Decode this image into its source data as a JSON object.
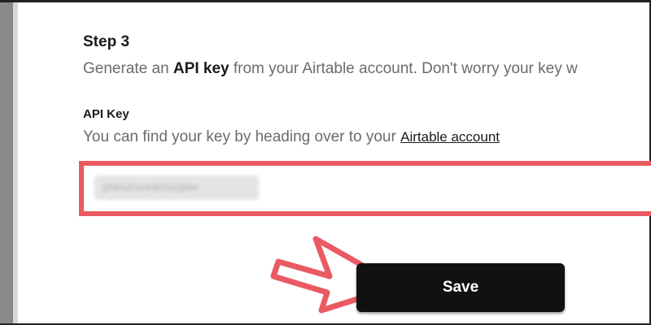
{
  "step": {
    "title": "Step 3",
    "desc_prefix": "Generate an ",
    "desc_bold": "API key",
    "desc_suffix": " from your Airtable account. Don't worry your key w"
  },
  "api_key": {
    "label": "API Key",
    "help_prefix": "You can find your key by heading over to your ",
    "help_link": "Airtable account",
    "value_obscured": "jjhbnj2ueedj1sj/(jtee"
  },
  "actions": {
    "save_label": "Save"
  },
  "colors": {
    "highlight": "#ea5a62",
    "button_bg": "#111111",
    "arrow_fill": "#ffffff",
    "arrow_stroke": "#ea5a62"
  },
  "icons": {
    "arrow": "pointer-arrow-icon"
  }
}
